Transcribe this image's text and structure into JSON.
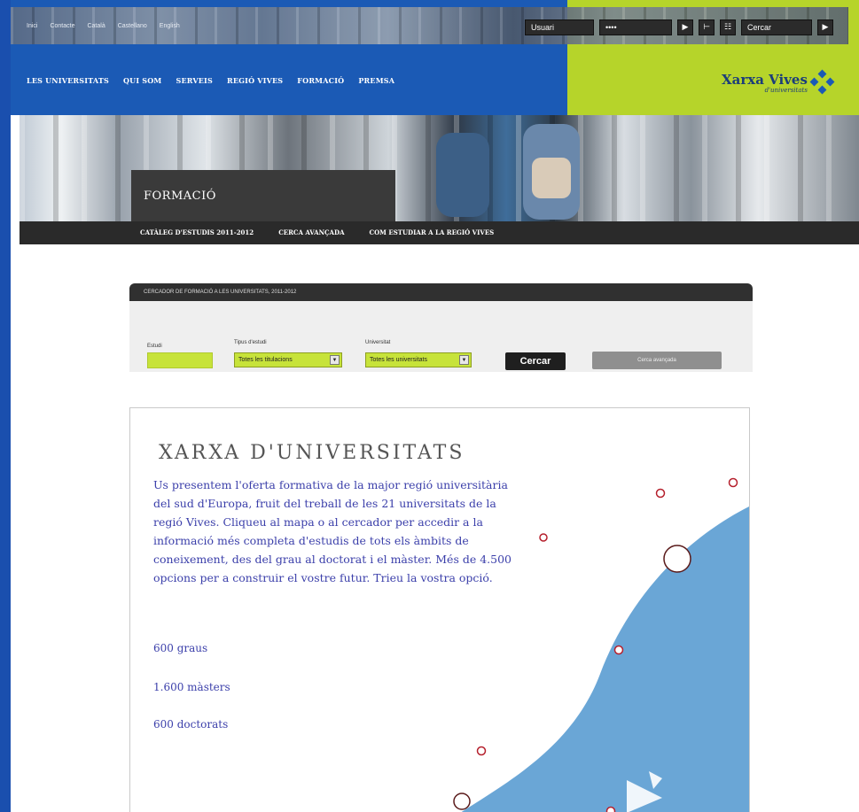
{
  "top_links": [
    "Inici",
    "Contacte",
    "Català",
    "Castellano",
    "English"
  ],
  "utility": {
    "user_label": "Usuari",
    "password_mask": "••••",
    "search_placeholder": "Cercar",
    "play": "▶",
    "next": "▶"
  },
  "nav": [
    "LES UNIVERSITATS",
    "QUI SOM",
    "SERVEIS",
    "REGIÓ VIVES",
    "FORMACIÓ",
    "PREMSA"
  ],
  "logo": {
    "title": "Xarxa Vives",
    "subtitle": "d'universitats"
  },
  "section": {
    "title": "FORMACIÓ"
  },
  "subnav": [
    "CATÀLEG D'ESTUDIS 2011-2012",
    "CERCA AVANÇADA",
    "COM ESTUDIAR A LA REGIÓ VIVES"
  ],
  "search": {
    "bar_text": "CERCADOR DE FORMACIÓ A LES UNIVERSITATS, 2011-2012",
    "field1_label": "Estudi",
    "field2_label": "Tipus d'estudi",
    "field2_value": "Totes les titulacions",
    "field3_label": "Universitat",
    "field3_value": "Totes les universitats",
    "button": "Cercar",
    "advanced_button": "Cerca avançada"
  },
  "content": {
    "title": "XARXA D'UNIVERSITATS",
    "intro": "Us presentem l'oferta formativa de la major regió universitària del sud d'Europa, fruit del treball de les 21 universitats de la regió Vives. Cliqueu al mapa o al cercador per accedir a la informació més completa d'estudis de tots els àmbits de coneixement, des del grau al doctorat i el màster. Més de 4.500 opcions per a construir el vostre futur. Trieu la vostra opció.",
    "stats": [
      "600 graus",
      "1.600 màsters",
      "600 doctorats"
    ]
  },
  "colors": {
    "nav_blue": "#1b5ab5",
    "accent_green": "#b6d42a",
    "map_blue": "#6aa6d6",
    "marker_red": "#b51f2c"
  }
}
